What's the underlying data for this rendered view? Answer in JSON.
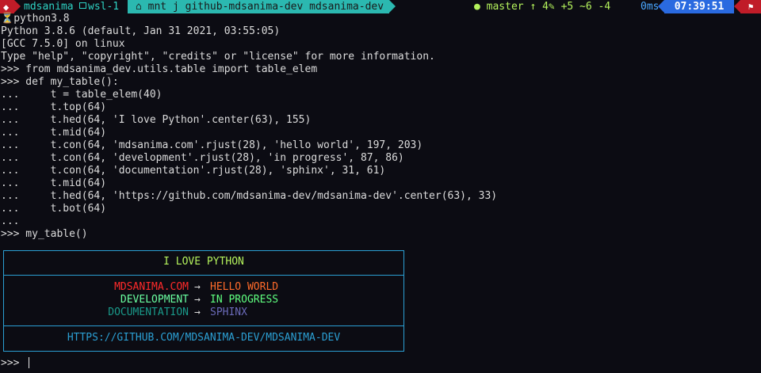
{
  "statusbar": {
    "os_icon": "linux-penguin-icon",
    "user": "mdsanima",
    "host_icon": "laptop-icon",
    "host": "wsl-1",
    "path_icon": "folder-home-icon",
    "path": "mnt  j  github-mdsanima-dev  mdsanima-dev",
    "git_icon": "github-icon",
    "git": "master ↑ 4✎ +5 ~6 -4",
    "elapsed": "0ms",
    "time": "07:39:51",
    "end_icon": "flag-icon"
  },
  "terminal": {
    "command_icon": "hourglass-icon",
    "command": "python3.8",
    "lines": [
      "Python 3.8.6 (default, Jan 31 2021, 03:55:05)",
      "[GCC 7.5.0] on linux",
      "Type \"help\", \"copyright\", \"credits\" or \"license\" for more information.",
      ">>> from mdsanima_dev.utils.table import table_elem",
      ">>> def my_table():",
      "...     t = table_elem(40)",
      "...     t.top(64)",
      "...     t.hed(64, 'I love Python'.center(63), 155)",
      "...     t.mid(64)",
      "...     t.con(64, 'mdsanima.com'.rjust(28), 'hello world', 197, 203)",
      "...     t.con(64, 'development'.rjust(28), 'in progress', 87, 86)",
      "...     t.con(64, 'documentation'.rjust(28), 'sphinx', 31, 61)",
      "...     t.mid(64)",
      "...     t.hed(64, 'https://github.com/mdsanima-dev/mdsanima-dev'.center(63), 33)",
      "...     t.bot(64)",
      "...",
      ">>> my_table()"
    ],
    "final_prompt": ">>> "
  },
  "table": {
    "header": {
      "text": "I LOVE PYTHON",
      "color": "#b4f25c"
    },
    "arrow": "→",
    "rows": [
      {
        "key": "MDSANIMA.COM",
        "value": "HELLO WORLD",
        "key_color": "#ff2a2a",
        "value_color": "#ff6b2a"
      },
      {
        "key": "DEVELOPMENT",
        "value": "IN PROGRESS",
        "key_color": "#6affa0",
        "value_color": "#5fff7f"
      },
      {
        "key": "DOCUMENTATION",
        "value": "SPHINX",
        "key_color": "#1a9a8a",
        "value_color": "#6a6ab8"
      }
    ],
    "footer": {
      "text": "HTTPS://GITHUB.COM/MDSANIMA-DEV/MDSANIMA-DEV",
      "color": "#2b9fd3"
    }
  }
}
